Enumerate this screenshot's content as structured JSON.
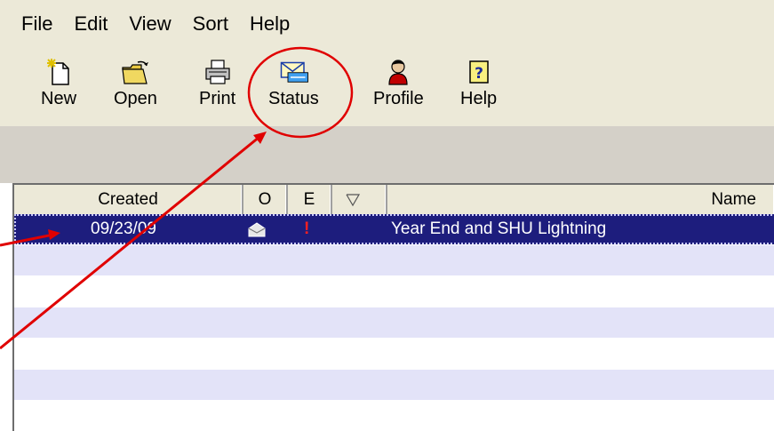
{
  "menubar": {
    "items": [
      "File",
      "Edit",
      "View",
      "Sort",
      "Help"
    ]
  },
  "toolbar": {
    "buttons": [
      {
        "label": "New",
        "icon": "new-document-icon"
      },
      {
        "label": "Open",
        "icon": "open-folder-icon"
      },
      {
        "label": "Print",
        "icon": "printer-icon"
      },
      {
        "label": "Status",
        "icon": "envelope-icon"
      },
      {
        "label": "Profile",
        "icon": "person-icon"
      },
      {
        "label": "Help",
        "icon": "help-icon"
      }
    ]
  },
  "list": {
    "columns": {
      "created": "Created",
      "o": "O",
      "e": "E",
      "flag": "",
      "name": "Name"
    },
    "rows": [
      {
        "created": "09/23/09",
        "opened_icon": "open-envelope-icon",
        "e": "!",
        "name": "Year End and SHU Lightning",
        "selected": true
      }
    ]
  },
  "annotation": {
    "highlight_color": "#e00000"
  }
}
